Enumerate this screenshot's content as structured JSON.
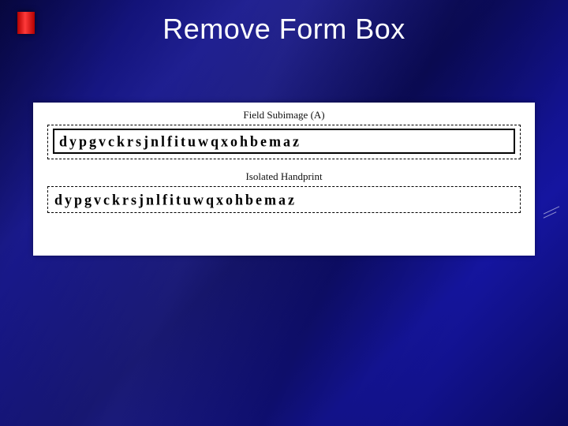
{
  "slide": {
    "title": "Remove Form Box"
  },
  "figure": {
    "caption_a": "Field Subimage (A)",
    "caption_b": "Isolated Handprint",
    "handprint_a": "dypgvckrsjnlfituwqxohbemaz",
    "handprint_b": "dypgvckrsjnlfituwqxohbemaz"
  }
}
